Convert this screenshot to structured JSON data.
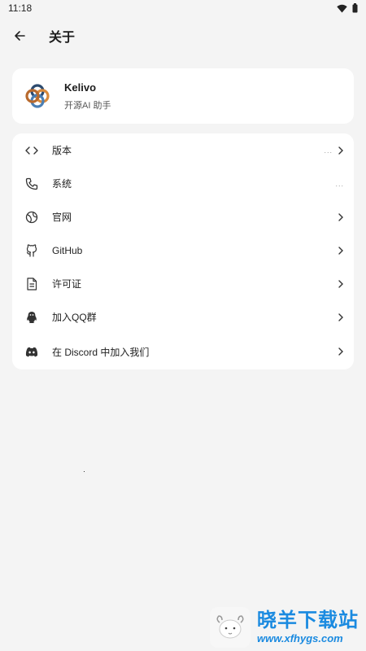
{
  "status_bar": {
    "time": "11:18"
  },
  "app_bar": {
    "title": "关于"
  },
  "app_info": {
    "name": "Kelivo",
    "description": "开源AI 助手"
  },
  "list": [
    {
      "label": "版本",
      "icon": "code-icon",
      "trailing": "...",
      "chevron": true
    },
    {
      "label": "系统",
      "icon": "phone-icon",
      "trailing": "...",
      "chevron": false
    },
    {
      "label": "官网",
      "icon": "globe-icon",
      "trailing": "",
      "chevron": true
    },
    {
      "label": "GitHub",
      "icon": "github-icon",
      "trailing": "",
      "chevron": true
    },
    {
      "label": "许可证",
      "icon": "document-icon",
      "trailing": "",
      "chevron": true
    },
    {
      "label": "加入QQ群",
      "icon": "qq-icon",
      "trailing": "",
      "chevron": true
    },
    {
      "label": "在 Discord 中加入我们",
      "icon": "discord-icon",
      "trailing": "",
      "chevron": true
    }
  ],
  "watermark": {
    "title": "晓羊下载站",
    "url": "www.xfhygs.com",
    "accent": "#1a8ae0"
  }
}
